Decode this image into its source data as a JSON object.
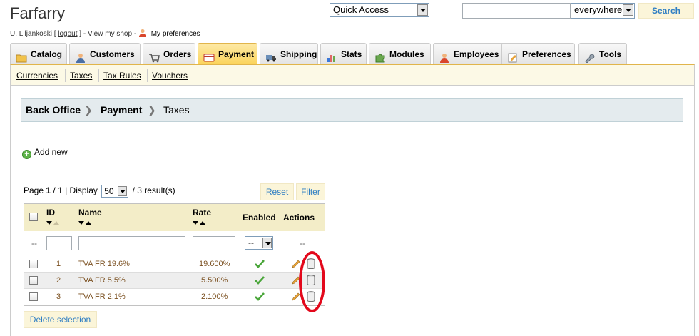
{
  "header": {
    "shop_title": "Farfarry",
    "user_name": "U. Liljankoski",
    "logout_label": "logout",
    "view_shop_label": "View my shop",
    "preferences_label": "My preferences",
    "quick_access_label": "Quick Access",
    "search_scope": "everywhere",
    "search_placeholder": "",
    "search_button_label": "Search"
  },
  "tabs": [
    {
      "label": "Catalog",
      "icon": "folder-icon"
    },
    {
      "label": "Customers",
      "icon": "customers-icon"
    },
    {
      "label": "Orders",
      "icon": "cart-icon"
    },
    {
      "label": "Payment",
      "icon": "payment-icon",
      "active": true
    },
    {
      "label": "Shipping",
      "icon": "truck-icon"
    },
    {
      "label": "Stats",
      "icon": "chart-icon"
    },
    {
      "label": "Modules",
      "icon": "puzzle-icon"
    },
    {
      "label": "Employees",
      "icon": "employee-icon"
    },
    {
      "label": "Preferences",
      "icon": "preferences-icon"
    },
    {
      "label": "Tools",
      "icon": "wrench-icon"
    }
  ],
  "subnav": [
    "Currencies",
    "Taxes",
    "Tax Rules",
    "Vouchers"
  ],
  "breadcrumb": [
    "Back Office",
    "Payment",
    "Taxes"
  ],
  "add_new_label": "Add new",
  "pagination": {
    "page_word": "Page",
    "current": "1",
    "of": "/ 1",
    "display_word": "| Display",
    "per_page": "50",
    "results": "/ 3 result(s)"
  },
  "buttons": {
    "reset": "Reset",
    "filter": "Filter",
    "delete_selection": "Delete selection"
  },
  "table": {
    "columns": {
      "id": "ID",
      "name": "Name",
      "rate": "Rate",
      "enabled": "Enabled",
      "actions": "Actions"
    },
    "filter_placeholder": "--",
    "enabled_filter_value": "--",
    "actions_filter": "--",
    "rows": [
      {
        "id": "1",
        "name": "TVA FR 19.6%",
        "rate": "19.600%",
        "enabled": true
      },
      {
        "id": "2",
        "name": "TVA FR 5.5%",
        "rate": "5.500%",
        "enabled": true
      },
      {
        "id": "3",
        "name": "TVA FR 2.1%",
        "rate": "2.100%",
        "enabled": true
      }
    ]
  },
  "colors": {
    "accent_blue": "#2e7ec3",
    "active_tab": "#fbd45c",
    "highlight_red": "#e3081b",
    "row_text": "#7b5020"
  }
}
